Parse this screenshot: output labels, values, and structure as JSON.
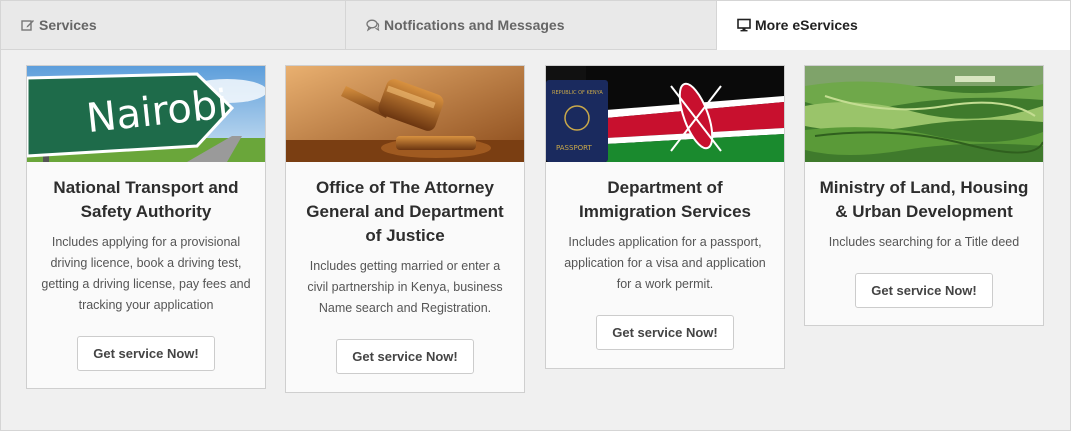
{
  "tabs": [
    {
      "label": "Services",
      "icon": "edit-icon"
    },
    {
      "label": "Notfications and Messages",
      "icon": "comments-icon"
    },
    {
      "label": "More eServices",
      "icon": "desktop-icon"
    }
  ],
  "active_tab": "More eServices",
  "cards": [
    {
      "title": "National Transport and Safety Authority",
      "description": "Includes applying for a provisional driving licence, book a driving test, getting a driving license, pay fees and tracking your application",
      "button": "Get service Now!",
      "image_text": "Nairobi"
    },
    {
      "title": "Office of The Attorney General and Department of Justice",
      "description": "Includes getting married or enter a civil partnership in Kenya, business Name search and Registration.",
      "button": "Get service Now!"
    },
    {
      "title": "Department of Immigration Services",
      "description": "Includes application for a passport, application for a visa and application for a work permit.",
      "button": "Get service Now!",
      "image_text": "REPUBLIC OF KENYA PASSPORT"
    },
    {
      "title": "Ministry of Land, Housing & Urban Development",
      "description": "Includes searching for a Title deed",
      "button": "Get service Now!"
    }
  ],
  "colors": {
    "tab_bg": "#e9e9e9",
    "active_tab_bg": "#ffffff",
    "panel_bg": "#f0f0f0",
    "card_bg": "#fafafa"
  }
}
